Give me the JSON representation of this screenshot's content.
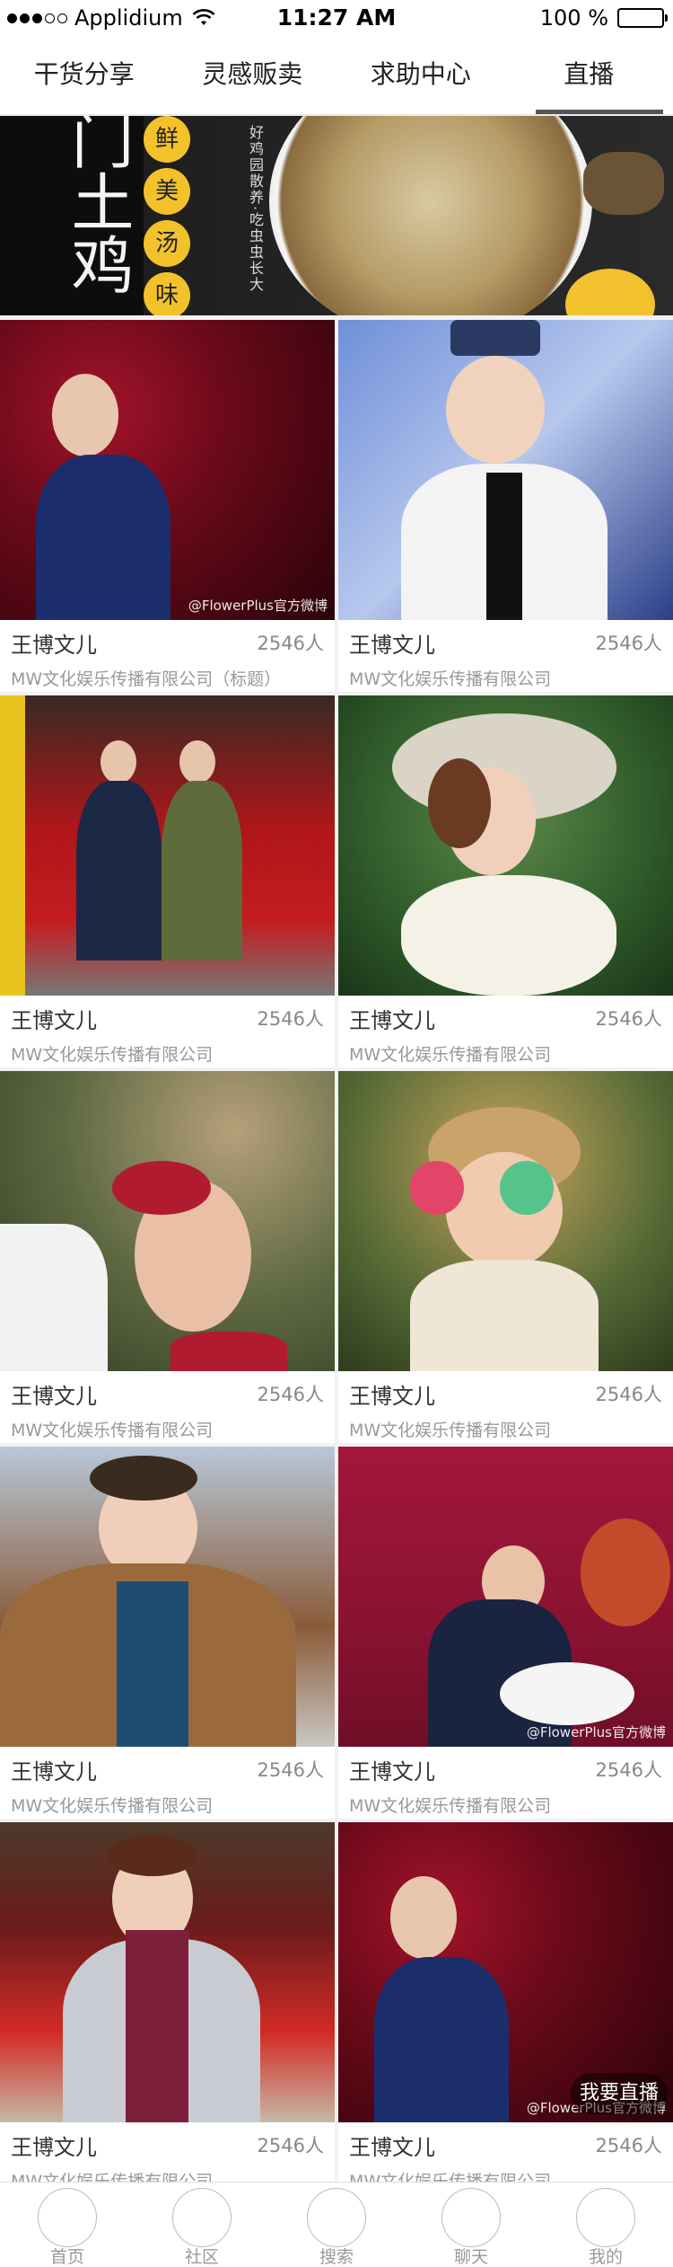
{
  "status_bar": {
    "carrier": "Applidium",
    "time": "11:27 AM",
    "battery": "100 %"
  },
  "tabs": [
    {
      "label": "干货分享",
      "active": false
    },
    {
      "label": "灵感贩卖",
      "active": false
    },
    {
      "label": "求助中心",
      "active": false
    },
    {
      "label": "直播",
      "active": true
    }
  ],
  "banner": {
    "big_text": "门土鸡",
    "badges": [
      "鲜",
      "美",
      "汤",
      "味"
    ],
    "vertical_text": "好鸡园散养·吃虫虫长大"
  },
  "cards": [
    {
      "name": "王博文儿",
      "count": "2546人",
      "company": "MW文化娱乐传播有限公司（标题）",
      "watermark": "@FlowerPlus官方微博"
    },
    {
      "name": "王博文儿",
      "count": "2546人",
      "company": "MW文化娱乐传播有限公司",
      "watermark": ""
    },
    {
      "name": "王博文儿",
      "count": "2546人",
      "company": "MW文化娱乐传播有限公司",
      "watermark": ""
    },
    {
      "name": "王博文儿",
      "count": "2546人",
      "company": "MW文化娱乐传播有限公司",
      "watermark": ""
    },
    {
      "name": "王博文儿",
      "count": "2546人",
      "company": "MW文化娱乐传播有限公司",
      "watermark": ""
    },
    {
      "name": "王博文儿",
      "count": "2546人",
      "company": "MW文化娱乐传播有限公司",
      "watermark": ""
    },
    {
      "name": "王博文儿",
      "count": "2546人",
      "company": "MW文化娱乐传播有限公司",
      "watermark": ""
    },
    {
      "name": "王博文儿",
      "count": "2546人",
      "company": "MW文化娱乐传播有限公司",
      "watermark": "@FlowerPlus官方微博"
    },
    {
      "name": "王博文儿",
      "count": "2546人",
      "company": "MW文化娱乐传播有限公司",
      "watermark": ""
    },
    {
      "name": "王博文儿",
      "count": "2546人",
      "company": "MW文化娱乐传播有限公司",
      "watermark": "@FlowerPlus官方微博"
    }
  ],
  "live_button": "我要直播",
  "bottom_nav": [
    {
      "label": "首页",
      "icon": "home-icon"
    },
    {
      "label": "社区",
      "icon": "community-icon"
    },
    {
      "label": "搜索",
      "icon": "search-icon"
    },
    {
      "label": "聊天",
      "icon": "chat-icon"
    },
    {
      "label": "我的",
      "icon": "profile-icon"
    }
  ],
  "colors": {
    "background": "#f2f2f2",
    "tab_indicator": "#555555",
    "banner_yellow": "#f3c22b"
  }
}
